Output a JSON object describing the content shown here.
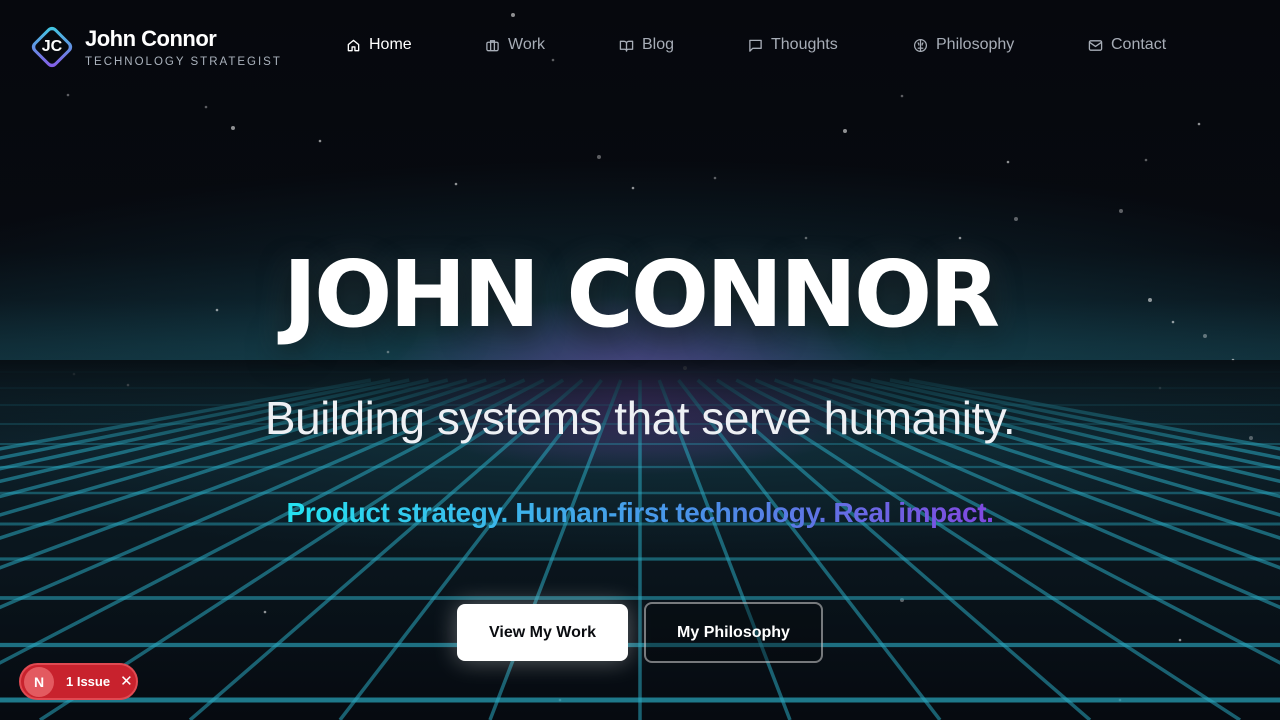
{
  "brand": {
    "monogram": "JC",
    "name": "John Connor",
    "subtitle": "TECHNOLOGY STRATEGIST"
  },
  "nav": {
    "items": [
      {
        "label": "Home",
        "icon": "home-icon",
        "active": true
      },
      {
        "label": "Work",
        "icon": "briefcase-icon",
        "active": false
      },
      {
        "label": "Blog",
        "icon": "book-icon",
        "active": false
      },
      {
        "label": "Thoughts",
        "icon": "chat-bubble-icon",
        "active": false
      },
      {
        "label": "Philosophy",
        "icon": "brain-icon",
        "active": false
      },
      {
        "label": "Contact",
        "icon": "mail-icon",
        "active": false
      }
    ]
  },
  "hero": {
    "title": "JOHN CONNOR",
    "subtitle": "Building systems that serve humanity.",
    "tagline": "Product strategy. Human-first technology. Real impact.",
    "primary_button": "View My Work",
    "secondary_button": "My Philosophy"
  },
  "dev_overlay": {
    "badge_letter": "N",
    "label": "1 Issue",
    "close": "✕"
  },
  "colors": {
    "background": "#05070b",
    "grid": "#2aa8bf",
    "tagline_gradient": [
      "#25e2f0",
      "#4b8ee8",
      "#8247e0"
    ],
    "issue_badge": "#c8222d"
  }
}
